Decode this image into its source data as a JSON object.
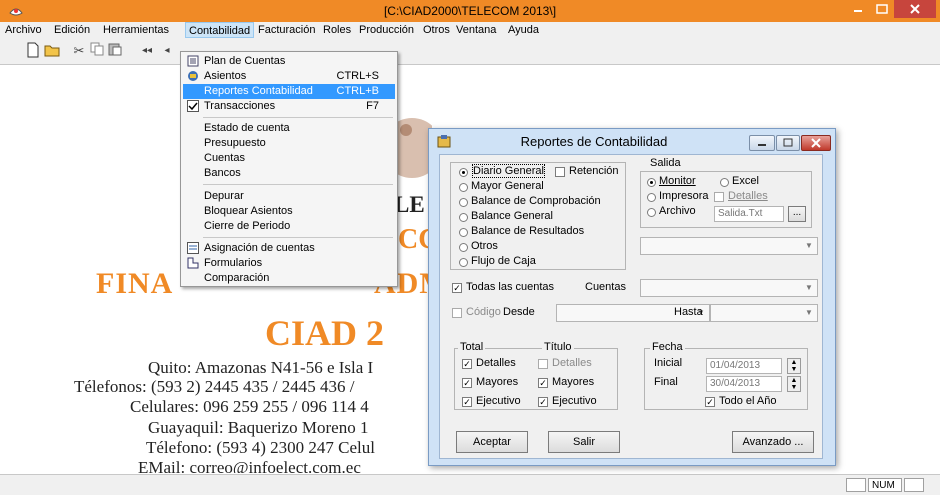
{
  "window": {
    "title": "[C:\\CIAD2000\\TELECOM 2013\\]"
  },
  "menubar": [
    "Archivo",
    "Edición",
    "Herramientas",
    "Contabilidad",
    "Facturación",
    "Roles",
    "Producción",
    "Otros",
    "Ventana",
    "Ayuda"
  ],
  "dropdown": {
    "items": [
      {
        "label": "Plan de Cuentas",
        "shortcut": "",
        "icon": "chart-icon"
      },
      {
        "label": "Asientos",
        "shortcut": "CTRL+S",
        "icon": "entries-icon"
      },
      {
        "label": "Reportes Contabilidad",
        "shortcut": "CTRL+B",
        "icon": ""
      },
      {
        "label": "Transacciones",
        "shortcut": "F7",
        "icon": "check-icon"
      },
      {
        "label": "Estado de cuenta",
        "shortcut": "",
        "icon": ""
      },
      {
        "label": "Presupuesto",
        "shortcut": "",
        "icon": ""
      },
      {
        "label": "Cuentas",
        "shortcut": "",
        "icon": ""
      },
      {
        "label": "Bancos",
        "shortcut": "",
        "icon": ""
      },
      {
        "label": "Depurar",
        "shortcut": "",
        "icon": ""
      },
      {
        "label": "Bloquear Asientos",
        "shortcut": "",
        "icon": ""
      },
      {
        "label": "Cierre de Periodo",
        "shortcut": "",
        "icon": ""
      },
      {
        "label": "Asignación  de cuentas",
        "shortcut": "",
        "icon": "assign-icon"
      },
      {
        "label": "Formularios",
        "shortcut": "",
        "icon": "forms-icon"
      },
      {
        "label": "Comparación",
        "shortcut": "",
        "icon": ""
      }
    ]
  },
  "background": {
    "line_le": "LE",
    "line_co": "CC",
    "line_fin": "FINA",
    "line_adm": "ADM",
    "line_ciad": "CIAD 2",
    "addr": [
      "Quito: Amazonas N41-56 e Isla I",
      "Télefonos: (593 2) 2445 435 / 2445 436 /",
      "Celulares: 096 259 255 / 096 114 4",
      "Guayaquil: Baquerizo Moreno 1",
      "Télefono: (593 4) 2300 247 Celul",
      "EMail: correo@infoelect.com.ec"
    ]
  },
  "statusbar": {
    "num": "NUM"
  },
  "dialog": {
    "title": "Reportes de Contabilidad",
    "report_types": [
      "Diario General",
      "Mayor General",
      "Balance de Comprobación",
      "Balance General",
      "Balance de Resultados",
      "Otros",
      "Flujo de Caja"
    ],
    "retencion": "Retención",
    "salida": {
      "title": "Salida",
      "monitor": "Monitor",
      "excel": "Excel",
      "impresora": "Impresora",
      "detalles": "Detalles",
      "archivo": "Archivo",
      "archivo_value": "Salida.Txt",
      "browse": "..."
    },
    "todas_cuentas": "Todas las cuentas",
    "cuentas_label": "Cuentas",
    "codigo": "Código",
    "desde": "Desde",
    "hasta": "Hasta",
    "total": {
      "title": "Total",
      "detalles": "Detalles",
      "mayores": "Mayores",
      "ejecutivo": "Ejecutivo"
    },
    "titulo": {
      "title": "Título",
      "detalles": "Detalles",
      "mayores": "Mayores",
      "ejecutivo": "Ejecutivo"
    },
    "fecha": {
      "title": "Fecha",
      "inicial_label": "Inicial",
      "inicial": "01/04/2013",
      "final_label": "Final",
      "final": "30/04/2013",
      "todo": "Todo el Año"
    },
    "buttons": {
      "aceptar": "Aceptar",
      "salir": "Salir",
      "avanzado": "Avanzado ..."
    }
  }
}
